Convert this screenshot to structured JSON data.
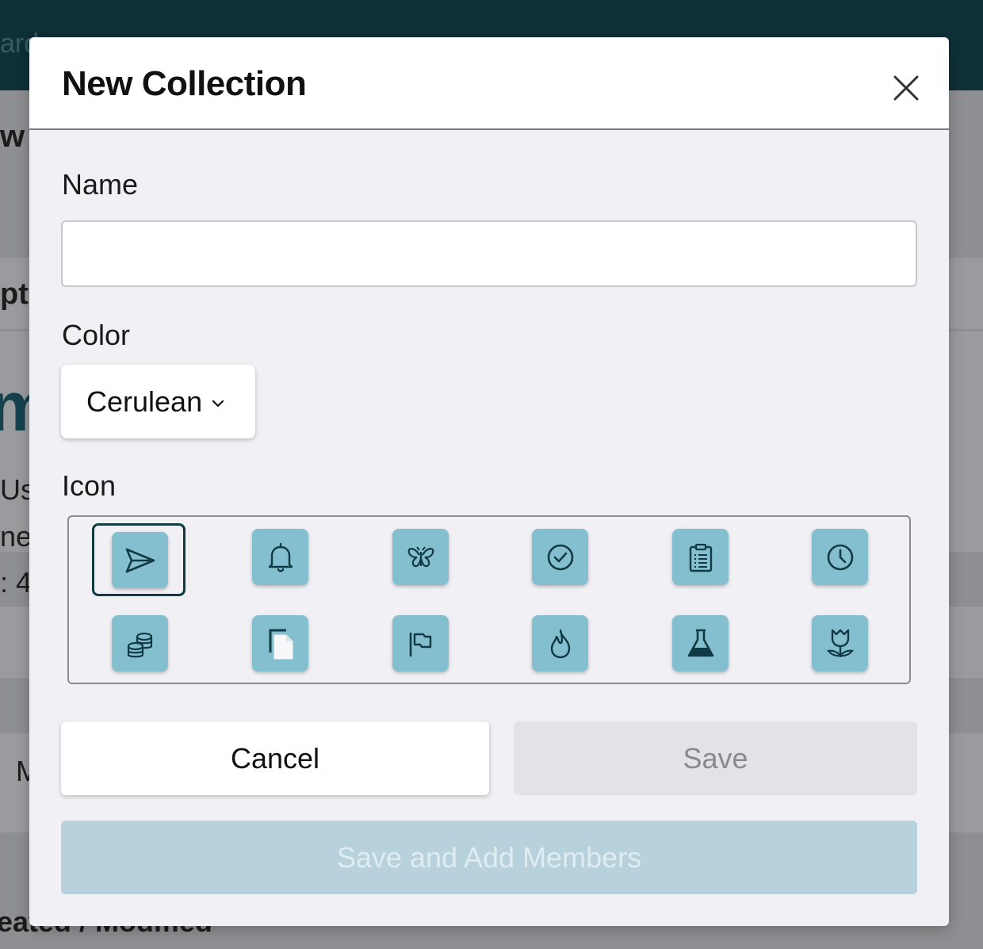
{
  "background": {
    "topbar_text": "ard",
    "fragments": [
      "w",
      "pti",
      "m",
      "Us",
      "ne",
      ": 4",
      "M",
      "eated / Modified"
    ]
  },
  "modal": {
    "title": "New Collection",
    "close_icon": "close-icon",
    "name": {
      "label": "Name",
      "value": "",
      "placeholder": ""
    },
    "color": {
      "label": "Color",
      "selected": "Cerulean",
      "chevron_icon": "chevron-down-icon"
    },
    "icon": {
      "label": "Icon",
      "selected_index": 0,
      "options": [
        "paper-plane-icon",
        "bell-icon",
        "butterfly-icon",
        "check-circle-icon",
        "clipboard-icon",
        "clock-icon",
        "coins-icon",
        "copy-icon",
        "flag-icon",
        "fire-icon",
        "flask-icon",
        "tulip-icon"
      ]
    },
    "buttons": {
      "cancel": "Cancel",
      "save": "Save",
      "save_and_add": "Save and Add Members"
    }
  },
  "colors": {
    "modal_bg": "#f0f0f5",
    "icon_tile": "#84bfcf",
    "icon_stroke": "#123a44",
    "selected_ring": "#123a44",
    "primary_disabled": "#b7d2dc",
    "topbar": "#0e3038"
  }
}
